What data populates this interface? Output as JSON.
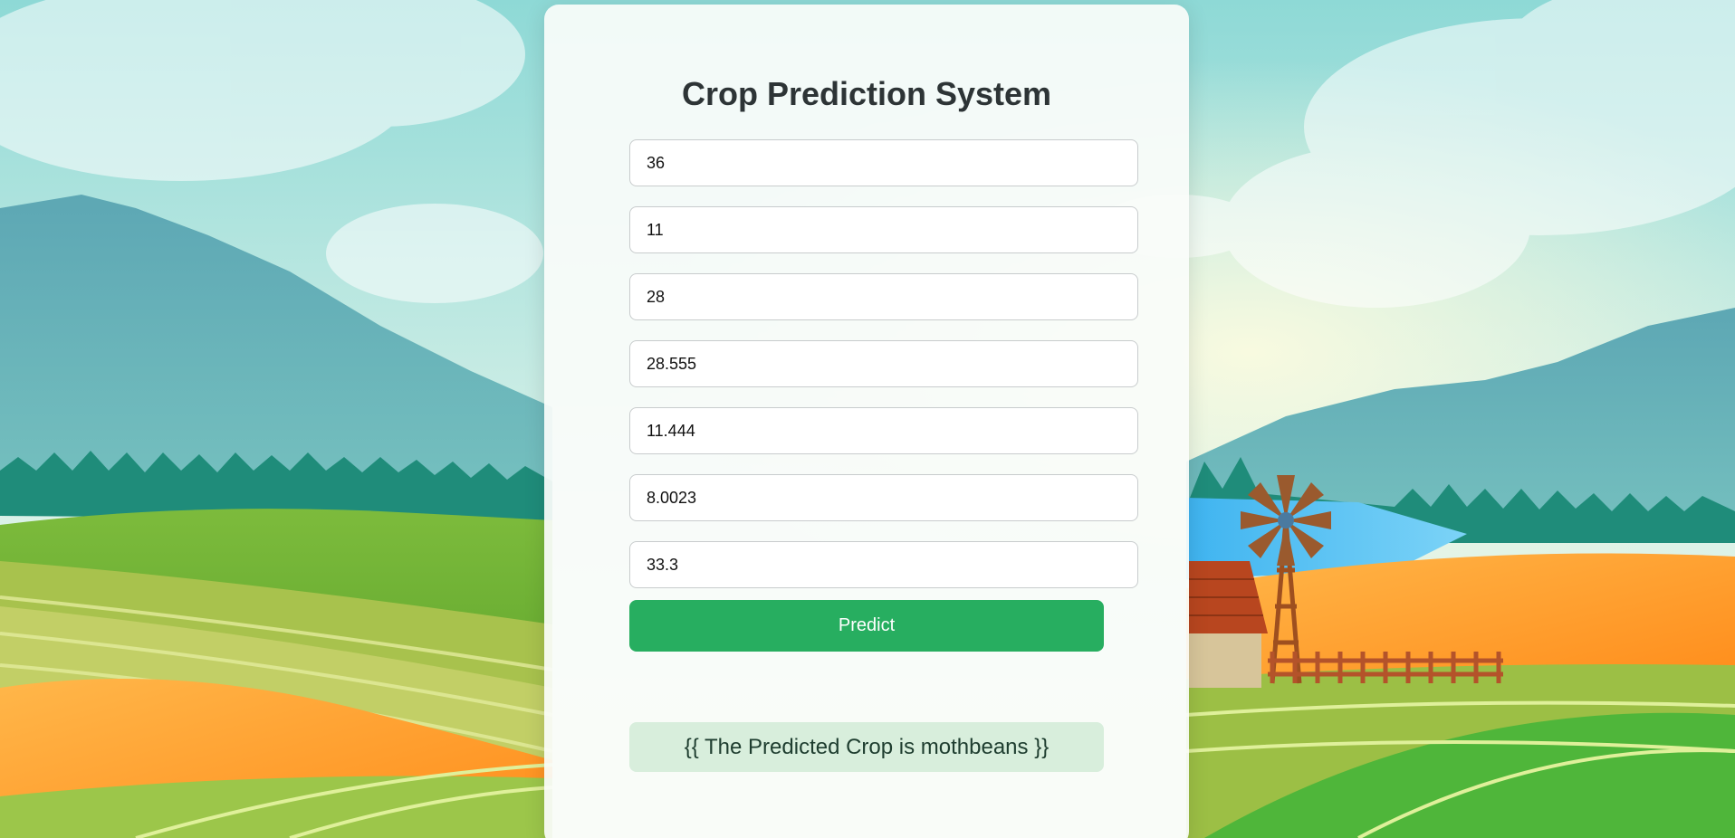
{
  "page": {
    "title": "Crop Prediction System"
  },
  "form": {
    "fields": [
      {
        "value": "36"
      },
      {
        "value": "11"
      },
      {
        "value": "28"
      },
      {
        "value": "28.555"
      },
      {
        "value": "11.444"
      },
      {
        "value": "8.0023"
      },
      {
        "value": "33.3"
      }
    ],
    "predict_label": "Predict"
  },
  "result": {
    "text": "{{ The Predicted Crop is mothbeans }}"
  },
  "colors": {
    "accent": "#27ae60",
    "result_bg": "#d8eedc",
    "title": "#2d3436"
  },
  "background": {
    "scene": "farm landscape with mountains, forest, fields, windmill, barn and fence"
  }
}
